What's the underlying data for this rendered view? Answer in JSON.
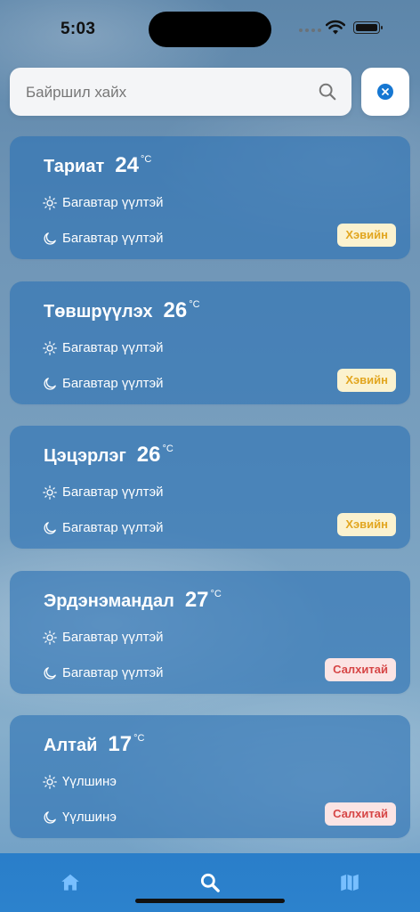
{
  "status": {
    "time": "5:03"
  },
  "search": {
    "placeholder": "Байршил хайх",
    "value": ""
  },
  "colors": {
    "accent": "#1677d2",
    "cool_badge": "#e2a620",
    "windy_badge": "#d64545"
  },
  "cards": [
    {
      "city": "Тариат",
      "temp": "24",
      "unit": "°C",
      "day": "Багавтар үүлтэй",
      "night": "Багавтар үүлтэй",
      "badge": "Хэвийн",
      "badge_type": "cool"
    },
    {
      "city": "Төвшрүүлэх",
      "temp": "26",
      "unit": "°C",
      "day": "Багавтар үүлтэй",
      "night": "Багавтар үүлтэй",
      "badge": "Хэвийн",
      "badge_type": "cool"
    },
    {
      "city": "Цэцэрлэг",
      "temp": "26",
      "unit": "°C",
      "day": "Багавтар үүлтэй",
      "night": "Багавтар үүлтэй",
      "badge": "Хэвийн",
      "badge_type": "cool"
    },
    {
      "city": "Эрдэнэмандал",
      "temp": "27",
      "unit": "°C",
      "day": "Багавтар үүлтэй",
      "night": "Багавтар үүлтэй",
      "badge": "Салхитай",
      "badge_type": "windy"
    },
    {
      "city": "Алтай",
      "temp": "17",
      "unit": "°C",
      "day": "Үүлшинэ",
      "night": "Үүлшинэ",
      "badge": "Салхитай",
      "badge_type": "windy"
    }
  ],
  "tabs": [
    {
      "icon": "home-icon",
      "active": false
    },
    {
      "icon": "search-icon",
      "active": true
    },
    {
      "icon": "map-icon",
      "active": false
    }
  ]
}
